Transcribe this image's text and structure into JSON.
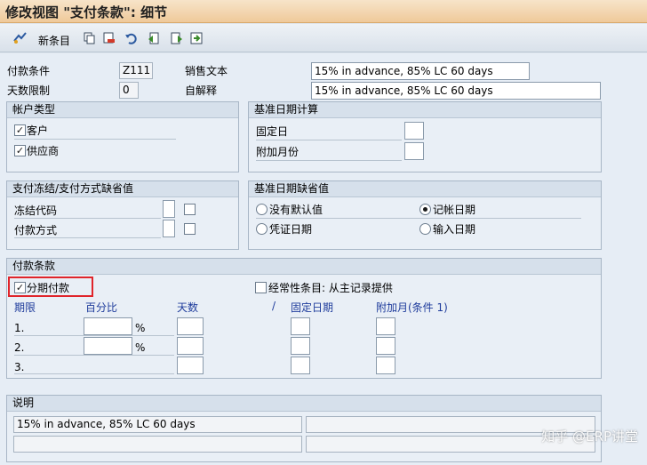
{
  "window": {
    "title": "修改视图 \"支付条款\": 细节"
  },
  "toolbar": {
    "new_entries_label": "新条目"
  },
  "header": {
    "payment_terms_label": "付款条件",
    "payment_terms_value": "Z111",
    "sales_text_label": "销售文本",
    "sales_text_value": "15% in advance, 85% LC 60 days",
    "day_limit_label": "天数限制",
    "day_limit_value": "0",
    "own_explanation_label": "自解释",
    "own_explanation_value": "15% in advance, 85% LC 60 days"
  },
  "account_type": {
    "title": "帐户类型",
    "customer_label": "客户",
    "customer_checked": true,
    "vendor_label": "供应商",
    "vendor_checked": true
  },
  "baseline_calc": {
    "title": "基准日期计算",
    "fixed_day_label": "固定日",
    "additional_months_label": "附加月份"
  },
  "payment_block": {
    "title": "支付冻结/支付方式缺省值",
    "block_key_label": "冻结代码",
    "payment_method_label": "付款方式"
  },
  "baseline_default": {
    "title": "基准日期缺省值",
    "no_default_label": "没有默认值",
    "posting_date_label": "记帐日期",
    "document_date_label": "凭证日期",
    "entry_date_label": "输入日期",
    "selected": "posting_date"
  },
  "payment_terms": {
    "title": "付款条款",
    "installment_label": "分期付款",
    "installment_checked": true,
    "recurring_label": "经常性条目: 从主记录提供",
    "recurring_checked": false,
    "col_term": "期限",
    "col_percent": "百分比",
    "col_days": "天数",
    "col_slash": "/",
    "col_fixed_date": "固定日期",
    "col_additional_month": "附加月(条件 1)",
    "percent_sign": "%",
    "rows": [
      "1.",
      "2.",
      "3."
    ]
  },
  "explanation": {
    "title": "说明",
    "line1": "15% in advance, 85% LC 60 days"
  },
  "watermark": "知乎 @ERP讲堂"
}
